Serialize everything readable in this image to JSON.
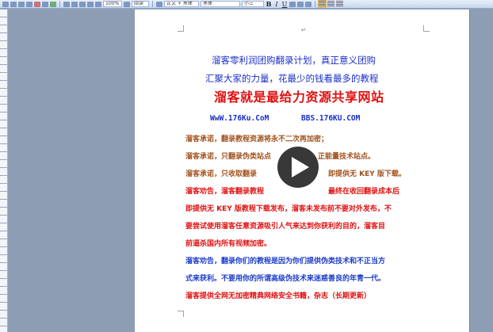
{
  "toolbar": {
    "zoom": "100%",
    "view_label": "阅读",
    "style": "正文 + 黑体",
    "font": "黑体",
    "size": "小三",
    "bold": "B",
    "italic": "I",
    "underline": "U"
  },
  "document": {
    "title_line_1": "溜客零利润团购翻录计划，真正意义团购",
    "title_line_2": "汇聚大家的力量，花最少的钱看最多的教程",
    "headline": "溜客就是最给力资源共享网站",
    "url_1": "WwW.176Ku.CoM",
    "url_2": "BBS.176KU.COM",
    "promise_1": "溜客承诺，翻录教程资源将永不二次再加密；",
    "promise_2_a": "溜客承诺，只翻录伪类站点",
    "promise_2_b": "正能量技术站点。",
    "promise_3_a": "溜客承诺，只收取翻录",
    "promise_3_b": "即提供无 KEY 版下载。",
    "advice_1_lines": [
      "溜客劝告，溜客翻录教程",
      "即提供无 KEY 版教程下载发布，溜客未发布前不要对外发布，不",
      "要尝试使用溜客任意资源吸引人气来达到你获利的目的，溜客目",
      "前逼杀国内所有视频加密。"
    ],
    "advice_1_tail": "最终在收回翻录成本后",
    "advice_2_lines": [
      "溜客劝告，翻录你们的教程是因为你们提供伪类技术和不正当方",
      "式来获利。不要用你的所谓高级伪技术来迷惑善良的年青一代。"
    ],
    "footer_line": "溜客提供全网无加密精典网络安全书籍，杂志（长期更新）"
  },
  "player": {
    "icon": "play-icon"
  }
}
